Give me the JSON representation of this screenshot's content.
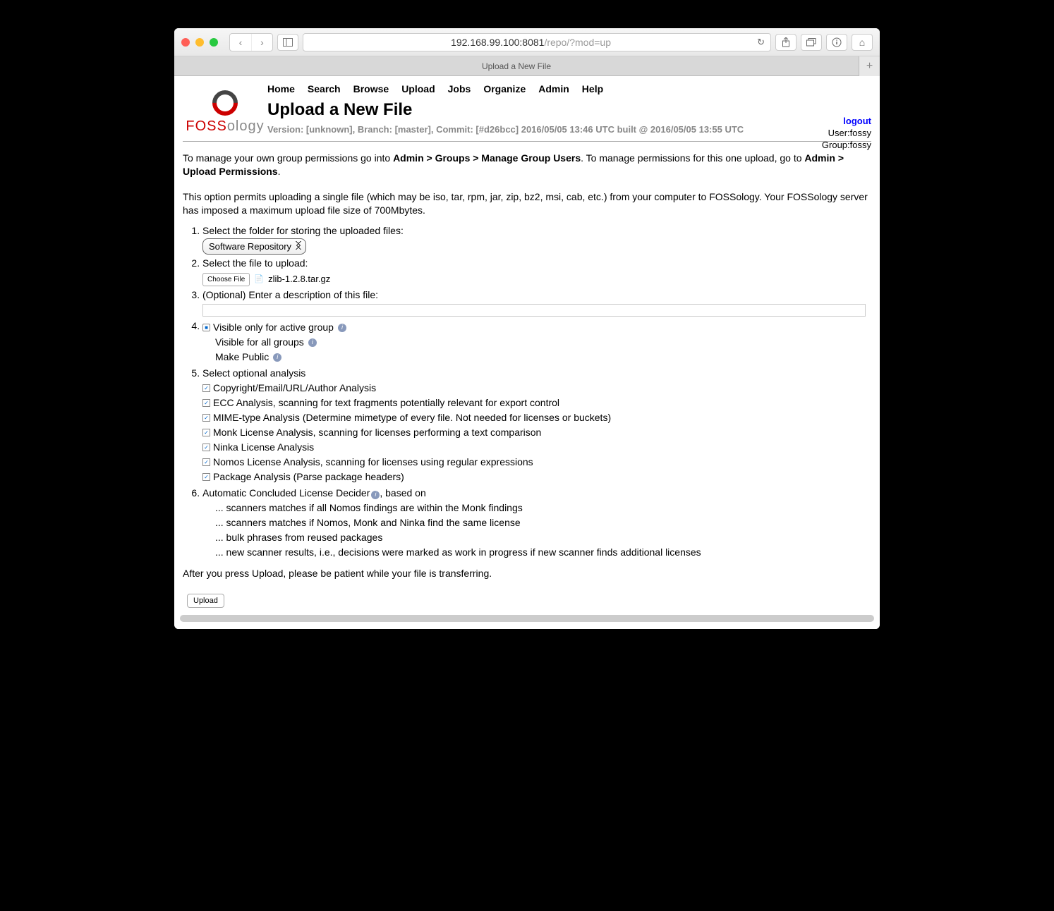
{
  "browser": {
    "url_prefix": "192.168.99.100:8081",
    "url_suffix": "/repo/?mod=up",
    "tab_title": "Upload a New File"
  },
  "nav": [
    "Home",
    "Search",
    "Browse",
    "Upload",
    "Jobs",
    "Organize",
    "Admin",
    "Help"
  ],
  "page_title": "Upload a New File",
  "version_line": "Version: [unknown], Branch: [master], Commit: [#d26bcc] 2016/05/05 13:46 UTC built @ 2016/05/05 13:55 UTC",
  "user": {
    "logout": "logout",
    "user_line": "User:fossy",
    "group_line": "Group:fossy"
  },
  "logo": {
    "text_foss": "FOSS",
    "text_ology": "ology"
  },
  "para1": {
    "pre": "To manage your own group permissions go into ",
    "b1": "Admin > Groups > Manage Group Users",
    "mid": ". To manage permissions for this one upload, go to ",
    "b2": "Admin > Upload Permissions",
    "post": "."
  },
  "para2": "This option permits uploading a single file (which may be iso, tar, rpm, jar, zip, bz2, msi, cab, etc.) from your computer to FOSSology. Your FOSSology server has imposed a maximum upload file size of 700Mbytes.",
  "step1": {
    "label": "Select the folder for storing the uploaded files:",
    "select_value": "Software Repository"
  },
  "step2": {
    "label": "Select the file to upload:",
    "choose_btn": "Choose File",
    "filename": "zlib-1.2.8.tar.gz"
  },
  "step3": {
    "label": "(Optional) Enter a description of this file:",
    "value": ""
  },
  "step4": {
    "options": [
      "Visible only for active group",
      "Visible for all groups",
      "Make Public"
    ],
    "selected": 0
  },
  "step5": {
    "label": "Select optional analysis",
    "options": [
      "Copyright/Email/URL/Author Analysis",
      "ECC Analysis, scanning for text fragments potentially relevant for export control",
      "MIME-type Analysis (Determine mimetype of every file. Not needed for licenses or buckets)",
      "Monk License Analysis, scanning for licenses performing a text comparison",
      "Ninka License Analysis",
      "Nomos License Analysis, scanning for licenses using regular expressions",
      "Package Analysis (Parse package headers)"
    ]
  },
  "step6": {
    "label_pre": "Automatic Concluded License Decider",
    "label_post": ", based on",
    "rules": [
      "... scanners matches if all Nomos findings are within the Monk findings",
      "... scanners matches if Nomos, Monk and Ninka find the same license",
      "... bulk phrases from reused packages",
      "... new scanner results, i.e., decisions were marked as work in progress if new scanner finds additional licenses"
    ]
  },
  "after_text": "After you press Upload, please be patient while your file is transferring.",
  "upload_btn": "Upload"
}
